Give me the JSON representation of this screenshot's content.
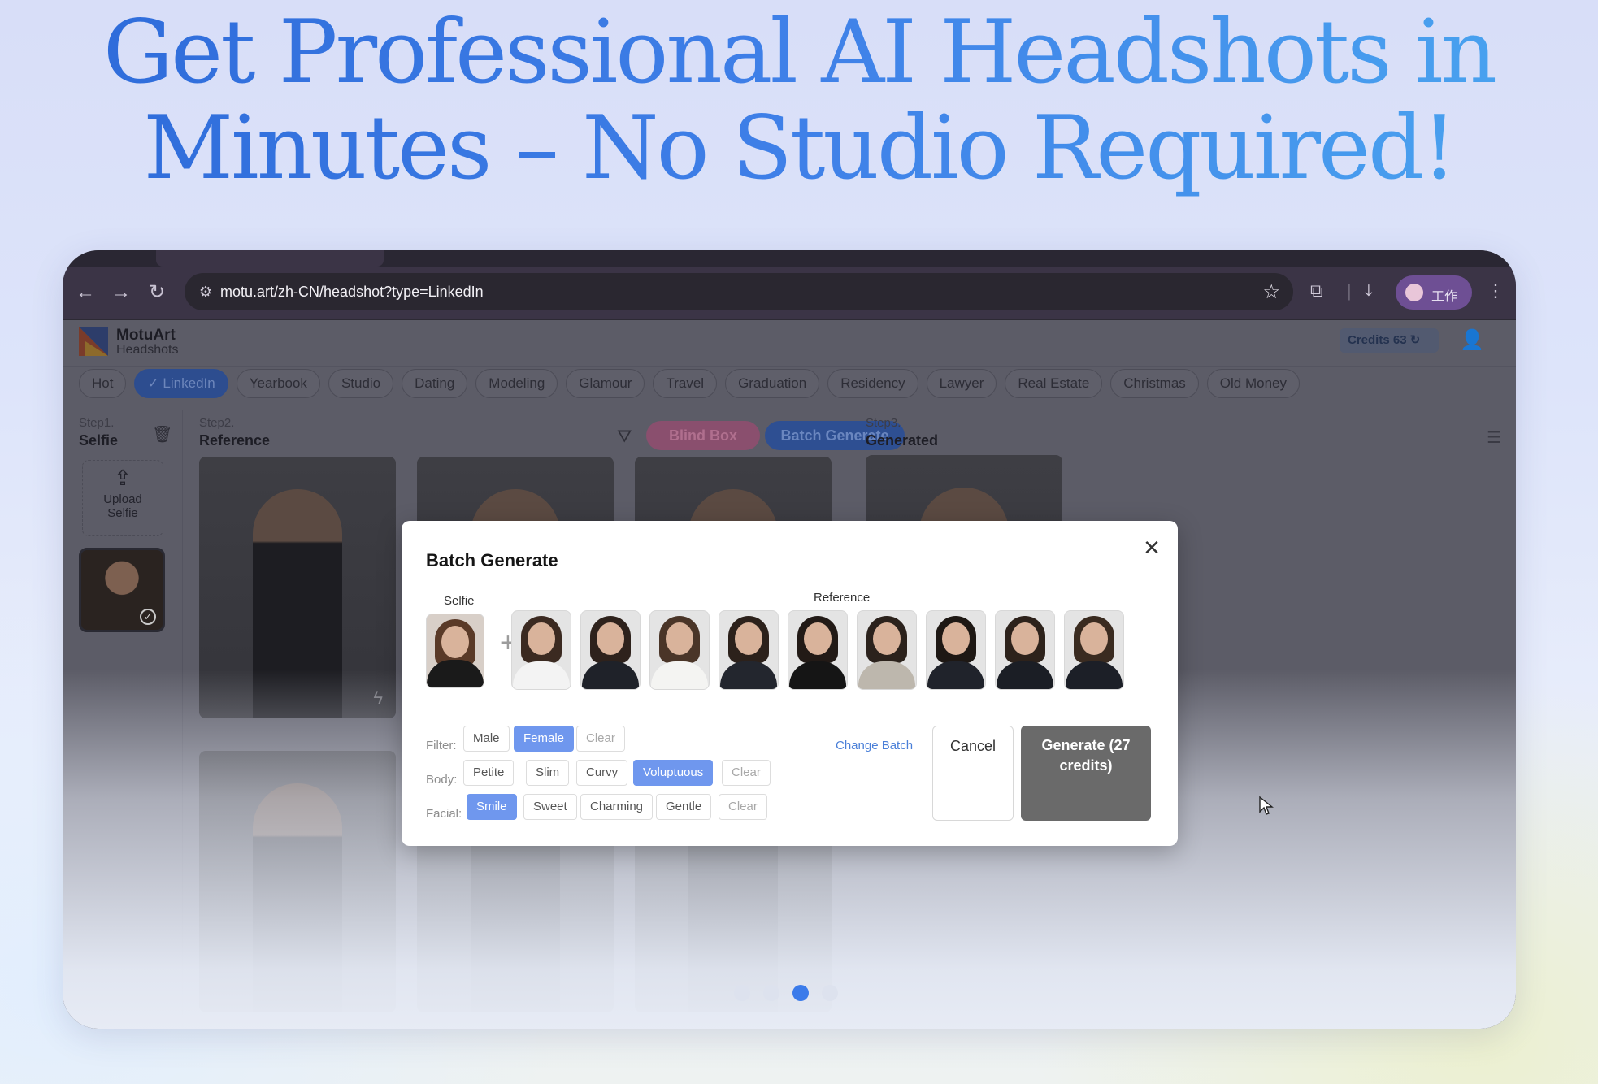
{
  "headline": {
    "line1": "Get Professional AI Headshots in",
    "line2": "Minutes – No Studio Required!"
  },
  "browser": {
    "url": "motu.art/zh-CN/headshot?type=LinkedIn",
    "profile_label": "工作",
    "icons": [
      "back-icon",
      "forward-icon",
      "reload-icon",
      "site-settings-icon",
      "bookmark-star-icon",
      "extensions-icon",
      "download-icon",
      "menu-icon"
    ]
  },
  "app": {
    "logo_name": "MotuArt",
    "logo_sub": "Headshots",
    "credits_label": "Credits 63",
    "categories": [
      {
        "label": "Hot",
        "active": false
      },
      {
        "label": "✓ LinkedIn",
        "active": true
      },
      {
        "label": "Yearbook",
        "active": false
      },
      {
        "label": "Studio",
        "active": false
      },
      {
        "label": "Dating",
        "active": false
      },
      {
        "label": "Modeling",
        "active": false
      },
      {
        "label": "Glamour",
        "active": false
      },
      {
        "label": "Travel",
        "active": false
      },
      {
        "label": "Graduation",
        "active": false
      },
      {
        "label": "Residency",
        "active": false
      },
      {
        "label": "Lawyer",
        "active": false
      },
      {
        "label": "Real Estate",
        "active": false
      },
      {
        "label": "Christmas",
        "active": false
      },
      {
        "label": "Old Money",
        "active": false
      }
    ],
    "step1": {
      "num": "Step1.",
      "title": "Selfie",
      "upload_line1": "Upload",
      "upload_line2": "Selfie"
    },
    "step2": {
      "num": "Step2.",
      "title": "Reference",
      "blind_box": "Blind Box",
      "batch_generate": "Batch Generate"
    },
    "step3": {
      "num": "Step3.",
      "title": "Generated"
    }
  },
  "modal": {
    "title": "Batch Generate",
    "selfie_label": "Selfie",
    "reference_label": "Reference",
    "reference_thumbs": [
      {
        "suit": "#f3f3f3",
        "hair": "#3b2a21"
      },
      {
        "suit": "#1f2229",
        "hair": "#2e221c"
      },
      {
        "suit": "#f4f4f2",
        "hair": "#4a3528"
      },
      {
        "suit": "#23262e",
        "hair": "#2c211b"
      },
      {
        "suit": "#151515",
        "hair": "#221a16"
      },
      {
        "suit": "#bdb7ad",
        "hair": "#2b221c"
      },
      {
        "suit": "#20232b",
        "hair": "#1e1814"
      },
      {
        "suit": "#1b1e25",
        "hair": "#2d221b"
      },
      {
        "suit": "#1c1f27",
        "hair": "#3a2b20"
      }
    ],
    "filter": {
      "label": "Filter:",
      "options": [
        {
          "label": "Male",
          "selected": false
        },
        {
          "label": "Female",
          "selected": true
        }
      ],
      "clear": "Clear"
    },
    "body": {
      "label": "Body:",
      "options": [
        {
          "label": "Petite",
          "selected": false
        },
        {
          "label": "Slim",
          "selected": false
        },
        {
          "label": "Curvy",
          "selected": false
        },
        {
          "label": "Voluptuous",
          "selected": true
        }
      ],
      "clear": "Clear"
    },
    "facial": {
      "label": "Facial:",
      "options": [
        {
          "label": "Smile",
          "selected": true
        },
        {
          "label": "Sweet",
          "selected": false
        },
        {
          "label": "Charming",
          "selected": false
        },
        {
          "label": "Gentle",
          "selected": false
        }
      ],
      "clear": "Clear"
    },
    "change_batch": "Change Batch",
    "cancel": "Cancel",
    "generate": "Generate (27 credits)"
  },
  "carousel": {
    "count": 4,
    "active_index": 2
  },
  "colors": {
    "accent": "#3b7bea",
    "chip_selected": "#6f97ee",
    "generate_button": "#6a6a6a"
  }
}
